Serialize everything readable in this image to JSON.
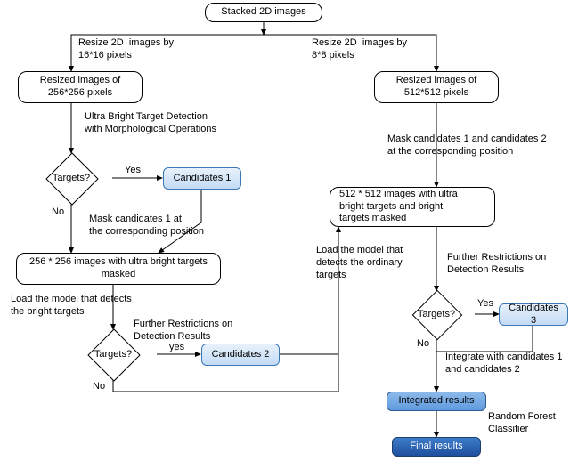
{
  "diagram": {
    "start": "Stacked 2D images",
    "resize_left": "Resize 2D  images by\n16*16 pixels",
    "resize_right": "Resize 2D  images by\n8*8 pixels",
    "resized256": "Resized images of\n256*256 pixels",
    "resized512": "Resized images of\n512*512 pixels",
    "ultra_bright_op": "Ultra Bright Target Detection\nwith Morphological Operations",
    "mask_cand12_right": "Mask candidates 1 and candidates 2\nat the corresponding position",
    "targets_q": "Targets?",
    "yes": "Yes",
    "yes_lower": "yes",
    "no": "No",
    "cand1": "Candidates 1",
    "mask_cand1": "Mask candidates 1 at\nthe corresponding position",
    "masked256": "256 * 256 images with ultra bright targets\nmasked",
    "load_bright": "Load the model that detects\nthe bright targets",
    "further": "Further Restrictions on\nDetection Results",
    "cand2": "Candidates 2",
    "masked512": "512 * 512 images with ultra\nbright targets and bright\ntargets masked",
    "load_ordinary": "Load the model that\ndetects the ordinary\ntargets",
    "cand3": "Candidates 3",
    "integrate": "Integrate with candidates 1\nand candidates 2",
    "int_results": "Integrated  results",
    "rf": "Random Forest\nClassifier",
    "final": "Final results"
  }
}
